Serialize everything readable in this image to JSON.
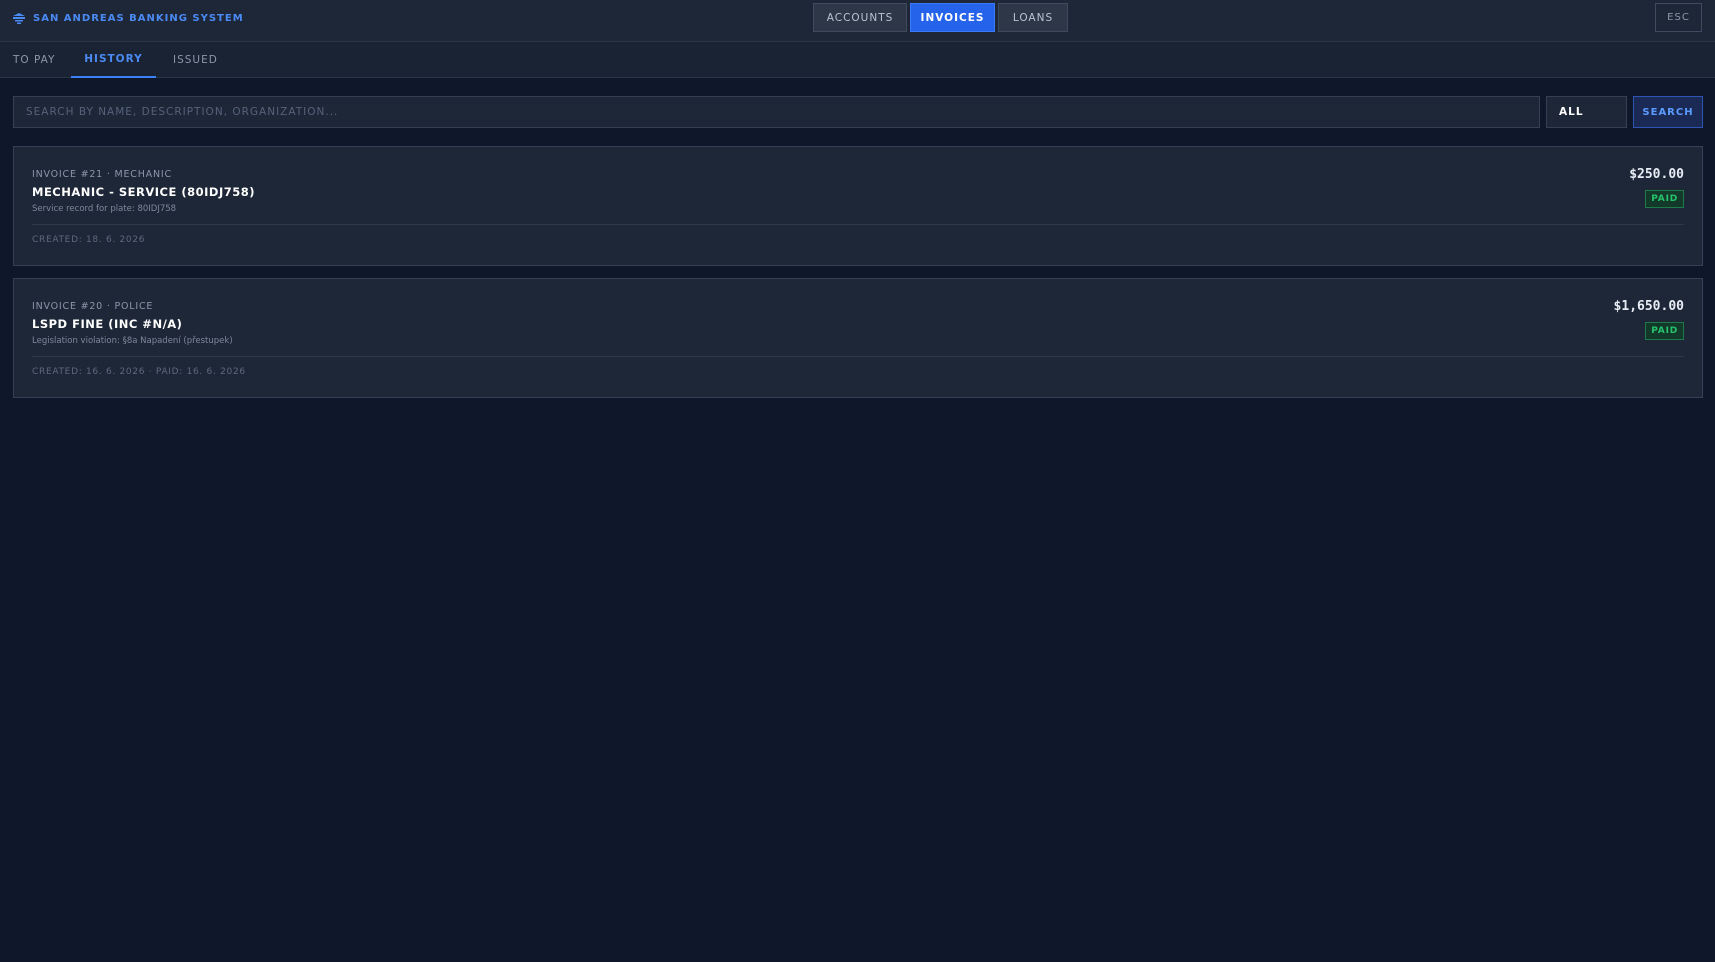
{
  "header": {
    "title": "SAN ANDREAS BANKING SYSTEM",
    "nav": [
      {
        "label": "ACCOUNTS",
        "active": false
      },
      {
        "label": "INVOICES",
        "active": true
      },
      {
        "label": "LOANS",
        "active": false
      }
    ],
    "esc_label": "ESC"
  },
  "subtabs": [
    {
      "label": "TO PAY",
      "active": false
    },
    {
      "label": "HISTORY",
      "active": true
    },
    {
      "label": "ISSUED",
      "active": false
    }
  ],
  "search": {
    "placeholder": "SEARCH BY NAME, DESCRIPTION, ORGANIZATION...",
    "value": "",
    "filter_value": "ALL",
    "button_label": "SEARCH"
  },
  "invoices": [
    {
      "meta": "INVOICE #21 · MECHANIC",
      "title": "MECHANIC - SERVICE (80IDJ758)",
      "description": "Service record for plate: 80IDJ758",
      "footer": "CREATED: 18. 6. 2026",
      "amount": "$250.00",
      "status": "PAID"
    },
    {
      "meta": "INVOICE #20 · POLICE",
      "title": "LSPD FINE (INC #N/A)",
      "description": "Legislation violation: §8a Napadení (přestupek)",
      "footer": "CREATED: 16. 6. 2026 · PAID: 16. 6. 2026",
      "amount": "$1,650.00",
      "status": "PAID"
    }
  ],
  "colors": {
    "background": "#0f172a",
    "accent": "#2563eb",
    "brand": "#4a8af4",
    "paid": "#27c46d"
  },
  "icons": {
    "brand": "bank-icon"
  }
}
